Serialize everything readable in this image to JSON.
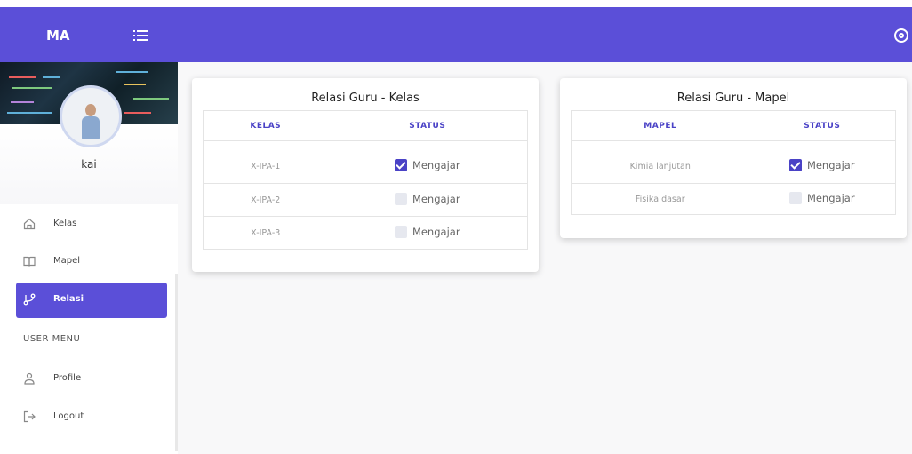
{
  "brand": "MA",
  "user": {
    "name": "kai"
  },
  "nav": {
    "items": [
      {
        "label": "Kelas"
      },
      {
        "label": "Mapel"
      },
      {
        "label": "Relasi"
      }
    ],
    "user_menu_title": "USER MENU",
    "user_items": [
      {
        "label": "Profile"
      },
      {
        "label": "Logout"
      }
    ]
  },
  "colors": {
    "accent": "#5b4fd8",
    "accent_dark": "#4a42c6"
  },
  "kelas_card": {
    "title": "Relasi Guru - Kelas",
    "headers": [
      "KELAS",
      "STATUS"
    ],
    "rows": [
      {
        "name": "X-IPA-1",
        "status": "Mengajar",
        "checked": true
      },
      {
        "name": "X-IPA-2",
        "status": "Mengajar",
        "checked": false
      },
      {
        "name": "X-IPA-3",
        "status": "Mengajar",
        "checked": false
      }
    ]
  },
  "mapel_card": {
    "title": "Relasi Guru - Mapel",
    "headers": [
      "MAPEL",
      "STATUS"
    ],
    "rows": [
      {
        "name": "Kimia lanjutan",
        "status": "Mengajar",
        "checked": true
      },
      {
        "name": "Fisika dasar",
        "status": "Mengajar",
        "checked": false
      }
    ]
  }
}
